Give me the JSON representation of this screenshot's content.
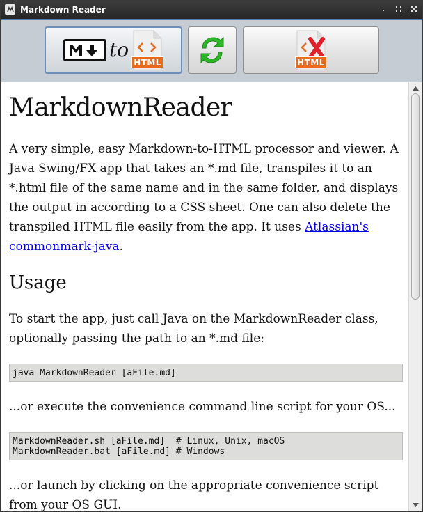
{
  "window": {
    "title": "Markdown Reader",
    "icon": "app-icon",
    "controls": [
      "minimize-icon",
      "maximize-icon",
      "close-icon"
    ]
  },
  "toolbar": {
    "convert_button": {
      "icon": "markdown-to-html-icon",
      "md_glyph": "M↓",
      "to_text": "to",
      "html_label": "HTML"
    },
    "reload_button": {
      "icon": "reload-icon"
    },
    "delete_button": {
      "icon": "delete-html-icon",
      "html_label": "HTML"
    }
  },
  "document": {
    "title": "MarkdownReader",
    "intro": "A very simple, easy Markdown-to-HTML processor and viewer. A Java Swing/FX app that takes an *.md file, transpiles it to an *.html file of the same name and in the same folder, and displays the output in according to a CSS sheet. One can also delete the transpiled HTML file easily from the app. It uses ",
    "intro_link": "Atlassian's commonmark-java",
    "intro_end": ".",
    "usage_heading": "Usage",
    "usage_text": "To start the app, just call Java on the MarkdownReader class, optionally passing the path to an *.md file:",
    "code1": "java MarkdownReader [aFile.md]",
    "script_text": "...or execute the convenience command line script for your OS...",
    "code2": "MarkdownReader.sh [aFile.md]  # Linux, Unix, macOS\nMarkdownReader.bat [aFile.md] # Windows",
    "gui_text": "...or launch by clicking on the appropriate convenience script from your OS GUI."
  },
  "colors": {
    "accent": "#4d7fb5",
    "link": "#0000ee",
    "html_badge": "#e76a1d",
    "reload_green": "#2fb52a",
    "delete_red": "#e0202a"
  }
}
